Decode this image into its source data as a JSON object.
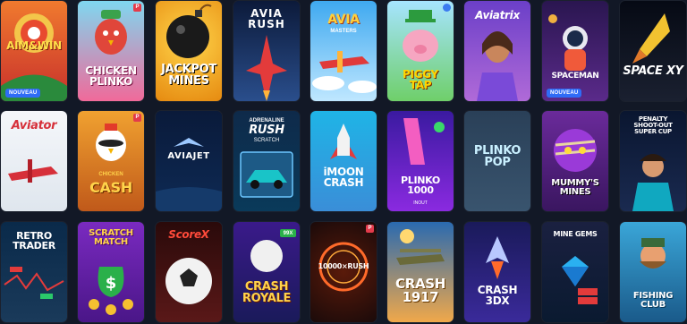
{
  "games": [
    {
      "title": "AIM&WIN",
      "badge": "NOUVEAU"
    },
    {
      "title": "CHICKEN\nPLINKO"
    },
    {
      "title": "JACKPOT\nMINES"
    },
    {
      "title": "AVIA\nRUSH"
    },
    {
      "title": "AVIA",
      "subtitle": "MASTERS"
    },
    {
      "title": "PIGGY\nTAP"
    },
    {
      "title": "Aviatrix"
    },
    {
      "title": "SPACEMAN",
      "badge": "NOUVEAU"
    },
    {
      "title": "SPACE XY"
    },
    {
      "title": "Aviator"
    },
    {
      "title": "CASH",
      "prefix": "CHICKEN"
    },
    {
      "title": "AVIAJET"
    },
    {
      "title": "RUSH",
      "prefix": "ADRENALINE",
      "subtitle": "SCRATCH"
    },
    {
      "title": "iMOON\nCRASH"
    },
    {
      "title": "PLINKO\n1000",
      "subtitle": "INOUT"
    },
    {
      "title": "PLINKO\nPOP"
    },
    {
      "title": "MUMMY'S\nMINES"
    },
    {
      "title": "PENALTY\nSHOOT-OUT\nSUPER CUP"
    },
    {
      "title": "RETRO\nTRADER"
    },
    {
      "title": "SCRATCH\nMATCH"
    },
    {
      "title": "ScoreX"
    },
    {
      "title": "CRASH\nROYALE",
      "tag": "99X"
    },
    {
      "title": "10000×RUSH"
    },
    {
      "title": "CRASH\n1917"
    },
    {
      "title": "CRASH\n3DX"
    },
    {
      "title": "MINE GEMS"
    },
    {
      "title": "FISHING\nCLUB"
    }
  ],
  "colors": {
    "background": "#121826",
    "badge": "#2f6cf6",
    "provider_flag": "#e33b4b"
  }
}
